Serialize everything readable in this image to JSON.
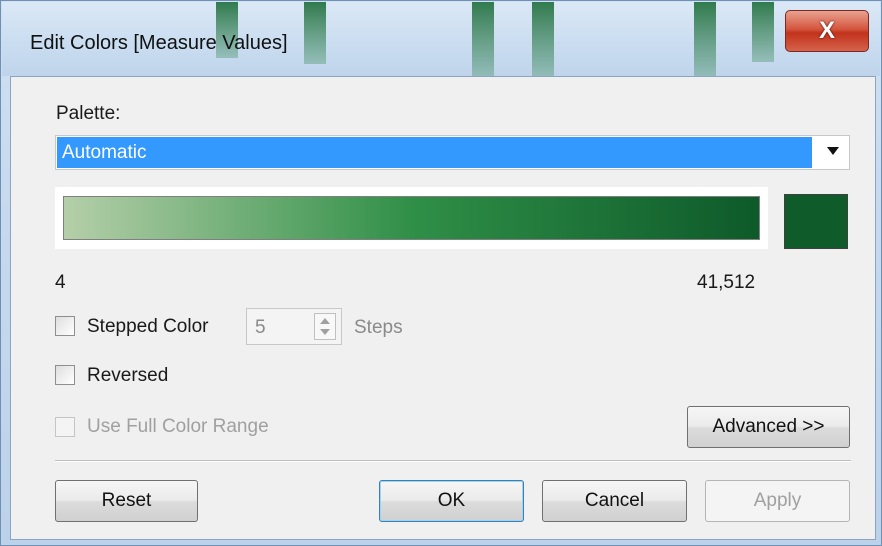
{
  "window": {
    "title": "Edit Colors [Measure Values]",
    "close_glyph": "X"
  },
  "palette": {
    "label": "Palette:",
    "selected": "Automatic"
  },
  "ramp": {
    "colors": [
      "#b5cfa9",
      "#2f8f47",
      "#0e5a2a"
    ],
    "end_swatch_color": "#0f5c2a",
    "min_label": "4",
    "max_label": "41,512"
  },
  "options": {
    "stepped_color": {
      "label": "Stepped Color",
      "checked": false
    },
    "steps": {
      "value": "5",
      "label": "Steps"
    },
    "reversed": {
      "label": "Reversed",
      "checked": false
    },
    "use_full_range": {
      "label": "Use Full Color Range",
      "checked": false,
      "enabled": false
    }
  },
  "buttons": {
    "advanced": "Advanced >>",
    "reset": "Reset",
    "ok": "OK",
    "cancel": "Cancel",
    "apply": "Apply"
  }
}
